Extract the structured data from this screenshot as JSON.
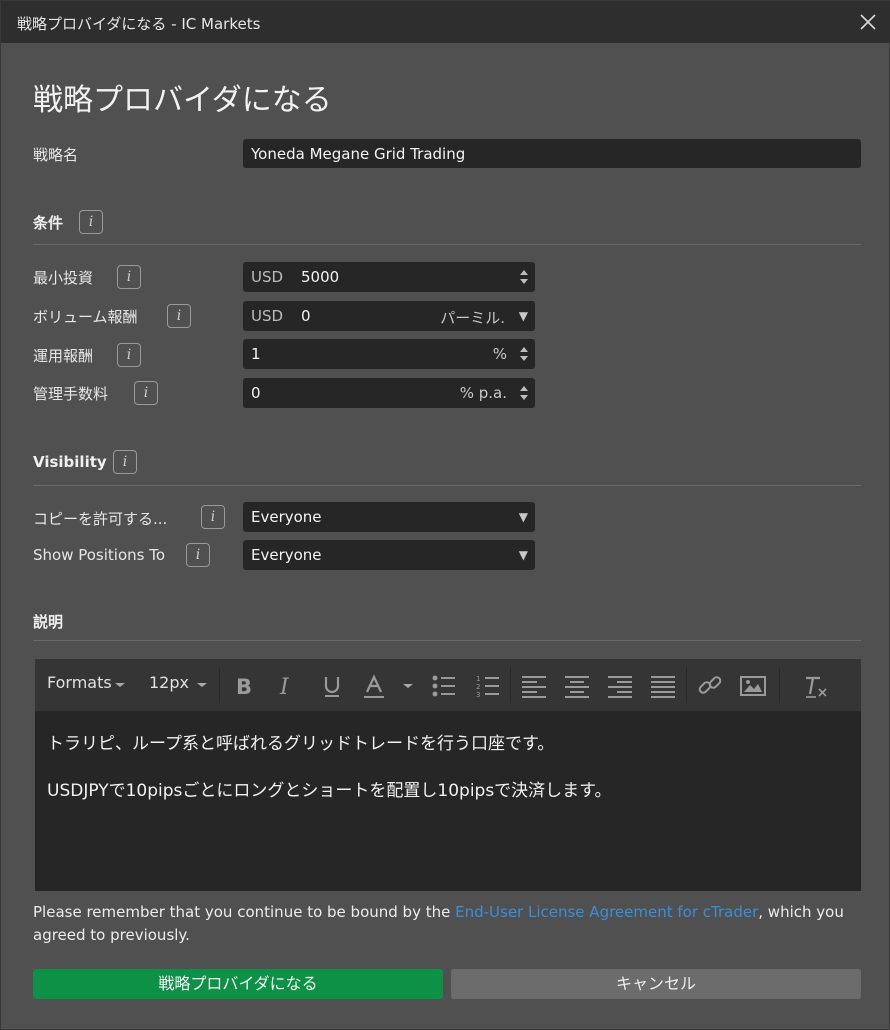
{
  "window": {
    "title": "戦略プロバイダになる - IC Markets"
  },
  "page": {
    "heading": "戦略プロバイダになる"
  },
  "strategy_name": {
    "label": "戦略名",
    "value": "Yoneda Megane Grid Trading"
  },
  "conditions": {
    "title": "条件",
    "min_investment": {
      "label": "最小投資",
      "currency": "USD",
      "value": "5000"
    },
    "volume_fee": {
      "label": "ボリューム報酬",
      "currency": "USD",
      "value": "0",
      "unit": "パーミル."
    },
    "performance_fee": {
      "label": "運用報酬",
      "value": "1",
      "unit": "%"
    },
    "management_fee": {
      "label": "管理手数料",
      "value": "0",
      "unit": "% p.a."
    }
  },
  "visibility": {
    "title": "Visibility",
    "copy_allowed": {
      "label": "コピーを許可する...",
      "value": "Everyone"
    },
    "show_positions": {
      "label": "Show Positions To",
      "value": "Everyone"
    }
  },
  "description": {
    "title": "説明",
    "toolbar": {
      "formats": "Formats",
      "font_size": "12px"
    },
    "paragraphs": [
      "トラリピ、ループ系と呼ばれるグリッドトレードを行う口座です。",
      "USDJPYで10pipsごとにロングとショートを配置し10pipsで決済します。"
    ]
  },
  "notice": {
    "before": "Please remember that you continue to be bound by the ",
    "link": "End-User License Agreement for cTrader",
    "after": ", which you agreed to previously."
  },
  "buttons": {
    "submit": "戦略プロバイダになる",
    "cancel": "キャンセル"
  },
  "info_glyph": "i",
  "colors": {
    "primary_button": "#0d9146",
    "link": "#3b8fd9",
    "panel": "#505050"
  }
}
